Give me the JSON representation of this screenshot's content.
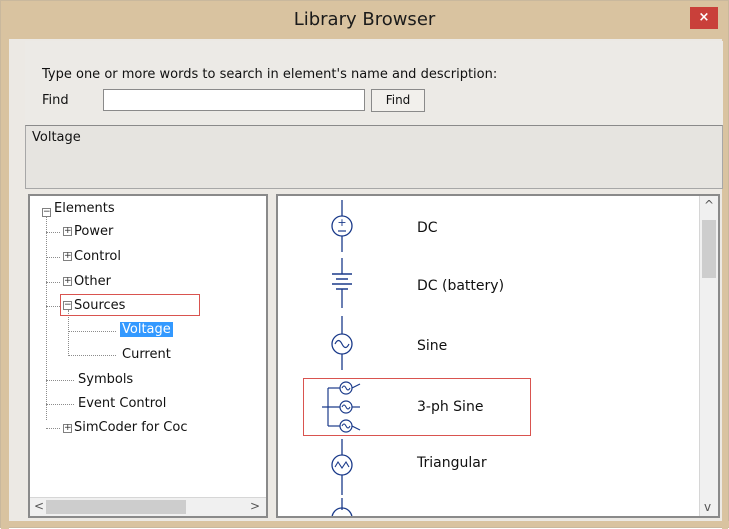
{
  "window": {
    "title": "Library Browser",
    "close_label": "×"
  },
  "search": {
    "instruction": "Type one or more words to search in element's name and  description:",
    "find_label": "Find",
    "find_value": "",
    "find_button": "Find"
  },
  "description": {
    "text": "Voltage"
  },
  "tree": {
    "items": [
      {
        "label": "Elements",
        "expander": "−"
      },
      {
        "label": "Power",
        "expander": "+"
      },
      {
        "label": "Control",
        "expander": "+"
      },
      {
        "label": "Other",
        "expander": "+"
      },
      {
        "label": "Sources",
        "expander": "−"
      },
      {
        "label": "Voltage",
        "selected": true
      },
      {
        "label": "Current"
      },
      {
        "label": "Symbols"
      },
      {
        "label": "Event Control"
      },
      {
        "label": "SimCoder for Coc",
        "expander": "+"
      }
    ],
    "scroll_left": "<",
    "scroll_right": ">"
  },
  "elements_list": {
    "items": [
      {
        "label": "DC",
        "icon": "dc-source-icon"
      },
      {
        "label": "DC (battery)",
        "icon": "battery-icon"
      },
      {
        "label": "Sine",
        "icon": "sine-source-icon"
      },
      {
        "label": "3-ph Sine",
        "icon": "three-phase-sine-icon",
        "highlighted": true
      },
      {
        "label": "Triangular",
        "icon": "triangular-source-icon"
      }
    ],
    "scroll_up": "^",
    "scroll_down": "v"
  },
  "colors": {
    "titlebar": "#d9c3a0",
    "selection": "#3399ff",
    "highlight": "#d9534f",
    "close": "#c9403a"
  }
}
